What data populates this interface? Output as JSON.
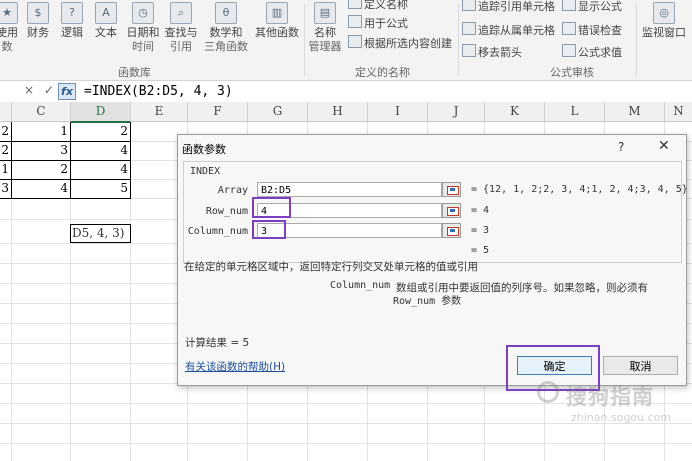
{
  "ribbon": {
    "function_buttons": [
      {
        "label": "使用",
        "sub": "数"
      },
      {
        "label": "财务",
        "sub": ""
      },
      {
        "label": "逻辑",
        "sub": ""
      },
      {
        "label": "文本",
        "sub": ""
      },
      {
        "label": "日期和",
        "sub": "时间"
      },
      {
        "label": "查找与",
        "sub": "引用"
      },
      {
        "label": "数学和",
        "sub": "三角函数"
      },
      {
        "label": "其他函数",
        "sub": ""
      }
    ],
    "function_group_label": "函数库",
    "name_manager": {
      "label": "名称",
      "sub": "管理器"
    },
    "names_commands": [
      "定义名称",
      "用于公式",
      "根据所选内容创建"
    ],
    "names_group_label": "定义的名称",
    "audit_commands": [
      "追踪引用单元格",
      "显示公式",
      "追踪从属单元格",
      "错误检查",
      "移去箭头",
      "公式求值"
    ],
    "audit_group_label": "公式审核",
    "watch_window": {
      "label": "监视窗口"
    }
  },
  "formula_bar": {
    "cancel_symbol": "×",
    "enter_symbol": "✓",
    "fx_label": "fx",
    "formula": "=INDEX(B2:D5, 4, 3)"
  },
  "sheet": {
    "columns": [
      "C",
      "D",
      "E",
      "F",
      "G",
      "H",
      "I",
      "J",
      "K",
      "L",
      "M",
      "N"
    ],
    "rows": [
      {
        "b": "2",
        "c": "1",
        "d": "2"
      },
      {
        "b": "2",
        "c": "3",
        "d": "4"
      },
      {
        "b": "1",
        "c": "2",
        "d": "4"
      },
      {
        "b": "3",
        "c": "4",
        "d": "5"
      }
    ],
    "active_cell_text": "D5, 4, 3)"
  },
  "dialog": {
    "title": "函数参数",
    "help_symbol": "?",
    "close_symbol": "✕",
    "function_name": "INDEX",
    "args": [
      {
        "label": "Array",
        "value": "B2:D5",
        "result": "= {12, 1, 2;2, 3, 4;1, 2, 4;3, 4, 5}"
      },
      {
        "label": "Row_num",
        "value": "4",
        "result": "= 4"
      },
      {
        "label": "Column_num",
        "value": "3",
        "result": "= 3"
      }
    ],
    "formula_result_preview": "= 5",
    "description": "在给定的单元格区域中，返回特定行列交叉处单元格的值或引用",
    "arg_help_name": "Column_num",
    "arg_help_line1": "数组或引用中要返回值的列序号。如果忽略，则必须有",
    "arg_help_line2": "Row_num 参数",
    "calc_result": "计算结果 =  5",
    "help_link": "有关该函数的帮助(H)",
    "ok_label": "确定",
    "cancel_label": "取消"
  },
  "watermark": {
    "text": "搜狗指南",
    "url": "zhinan.sogou.com"
  },
  "colors": {
    "highlight": "#7b3fc0",
    "excel_green": "#217346",
    "link": "#1f4e9c"
  }
}
